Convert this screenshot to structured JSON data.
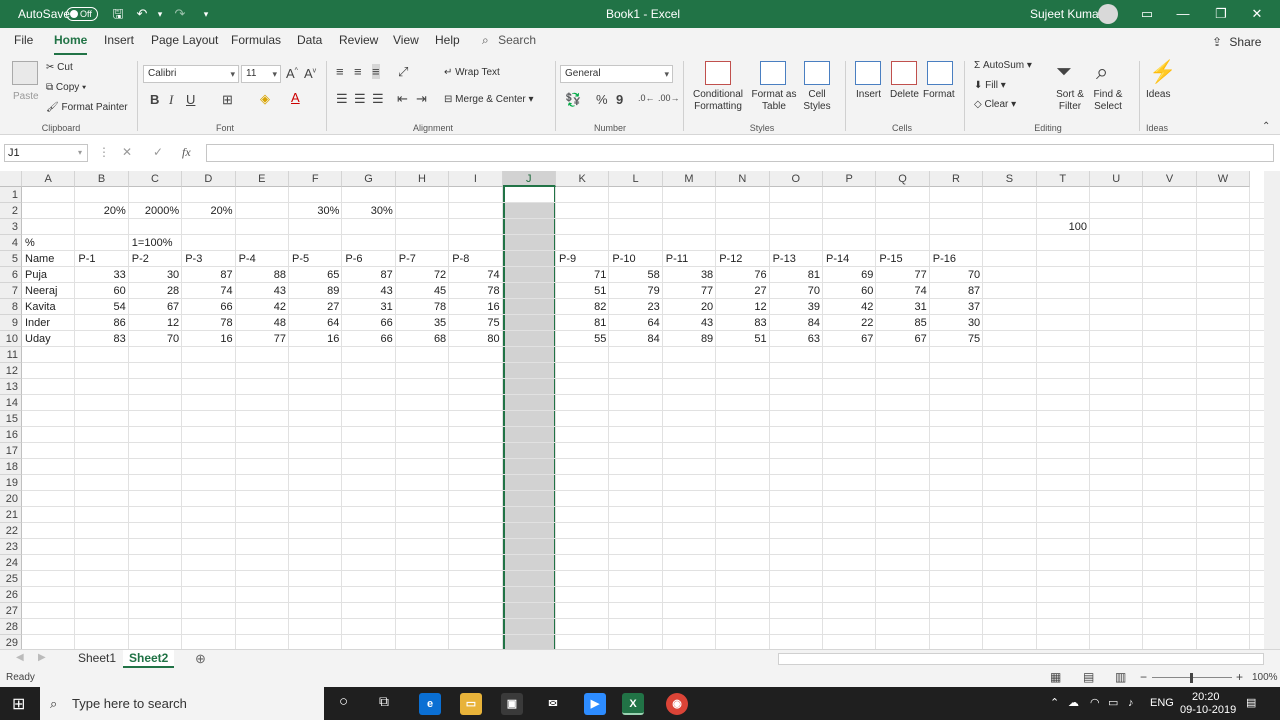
{
  "window": {
    "autosave_label": "AutoSave",
    "autosave_state": "Off",
    "title": "Book1 - Excel",
    "user_name": "Sujeet Kumar"
  },
  "menu": {
    "tabs": [
      "File",
      "Home",
      "Insert",
      "Page Layout",
      "Formulas",
      "Data",
      "Review",
      "View",
      "Help"
    ],
    "search_label": "Search",
    "share_label": "Share"
  },
  "ribbon": {
    "clipboard": {
      "paste": "Paste",
      "cut": "Cut",
      "copy": "Copy",
      "format_painter": "Format Painter",
      "label": "Clipboard"
    },
    "font": {
      "family": "Calibri",
      "size": "11",
      "label": "Font"
    },
    "alignment": {
      "wrap": "Wrap Text",
      "merge": "Merge & Center",
      "label": "Alignment"
    },
    "number": {
      "format": "General",
      "label": "Number"
    },
    "styles": {
      "conditional": "Conditional Formatting",
      "format_table": "Format as Table",
      "cell_styles": "Cell Styles",
      "label": "Styles"
    },
    "cells": {
      "insert": "Insert",
      "delete": "Delete",
      "format": "Format",
      "label": "Cells"
    },
    "editing": {
      "autosum": "AutoSum",
      "fill": "Fill",
      "clear": "Clear",
      "sort": "Sort & Filter",
      "find": "Find & Select",
      "label": "Editing"
    },
    "ideas": {
      "ideas": "Ideas",
      "label": "Ideas"
    }
  },
  "formula_bar": {
    "name_box": "J1",
    "fx": "fx",
    "content": ""
  },
  "sheet": {
    "columns": [
      "A",
      "B",
      "C",
      "D",
      "E",
      "F",
      "G",
      "H",
      "I",
      "J",
      "K",
      "L",
      "M",
      "N",
      "O",
      "P",
      "Q",
      "R",
      "S",
      "T",
      "U",
      "V",
      "W"
    ],
    "selected_column": "J",
    "row_count": 29,
    "row2": {
      "B": "20%",
      "C": "2000%",
      "D": "20%",
      "F": "30%",
      "G": "30%"
    },
    "row3": {
      "T": "100"
    },
    "row4": {
      "A": "%",
      "C": "1=100%"
    },
    "header_row": {
      "A": "Name",
      "B": "P-1",
      "C": "P-2",
      "D": "P-3",
      "E": "P-4",
      "F": "P-5",
      "G": "P-6",
      "H": "P-7",
      "I": "P-8",
      "K": "P-9",
      "L": "P-10",
      "M": "P-11",
      "N": "P-12",
      "O": "P-13",
      "P": "P-14",
      "Q": "P-15",
      "R": "P-16"
    },
    "data_rows": [
      {
        "name": "Puja",
        "values": [
          33,
          30,
          87,
          88,
          65,
          87,
          72,
          74,
          71,
          58,
          38,
          76,
          81,
          69,
          77,
          70
        ]
      },
      {
        "name": "Neeraj",
        "values": [
          60,
          28,
          74,
          43,
          89,
          43,
          45,
          78,
          51,
          79,
          77,
          27,
          70,
          60,
          74,
          87
        ]
      },
      {
        "name": "Kavita",
        "values": [
          54,
          67,
          66,
          42,
          27,
          31,
          78,
          16,
          82,
          23,
          20,
          12,
          39,
          42,
          31,
          37
        ]
      },
      {
        "name": "Inder",
        "values": [
          86,
          12,
          78,
          48,
          64,
          66,
          35,
          75,
          81,
          64,
          43,
          83,
          84,
          22,
          85,
          30
        ]
      },
      {
        "name": "Uday",
        "values": [
          83,
          70,
          16,
          77,
          16,
          66,
          68,
          80,
          55,
          84,
          89,
          51,
          63,
          67,
          67,
          75
        ]
      }
    ]
  },
  "sheet_tabs": [
    "Sheet1",
    "Sheet2"
  ],
  "active_sheet": "Sheet2",
  "status": {
    "text": "Ready",
    "zoom": "100%"
  },
  "taskbar": {
    "search_placeholder": "Type here to search",
    "language": "ENG",
    "time": "20:20",
    "date": "09-10-2019"
  },
  "colors": {
    "accent": "#217346",
    "selected_column_fill": "#d2d2d2"
  }
}
